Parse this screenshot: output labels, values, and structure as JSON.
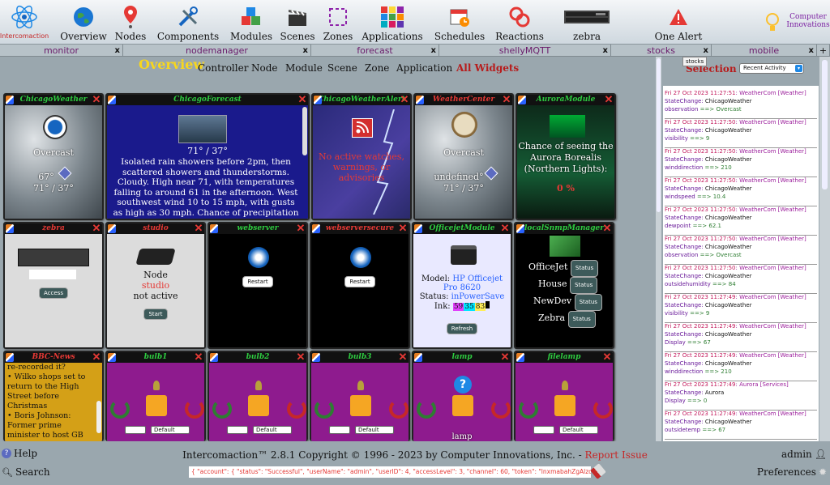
{
  "app": {
    "brand": "Intercomaction",
    "corner": "Computer Innovations"
  },
  "nav": [
    "Overview",
    "Nodes",
    "Components",
    "Modules",
    "Scenes",
    "Zones",
    "Applications",
    "Schedules",
    "Reactions",
    "zebra",
    "One Alert"
  ],
  "tabs": [
    "monitor",
    "nodemanager",
    "forecast",
    "shellyMQTT",
    "stocks",
    "mobile"
  ],
  "tab_close": "x",
  "tab_plus": "+",
  "tooltip": "stocks",
  "subnav": {
    "title": "Overview",
    "items": [
      "Controller",
      "Node",
      "Module",
      "Scene",
      "Zone",
      "Application"
    ],
    "active": "All Widgets"
  },
  "sidebar": {
    "title": "Selection",
    "select": "Recent Activity",
    "events": [
      {
        "time": "Fri 27 Oct 2023 11:27:51",
        "src": "WeatherCom [Weather]",
        "who": "ChicagoWeather",
        "key": "observation",
        "val": "Overcast"
      },
      {
        "time": "Fri 27 Oct 2023 11:27:50",
        "src": "WeatherCom [Weather]",
        "who": "ChicagoWeather",
        "key": "visibility",
        "val": "9"
      },
      {
        "time": "Fri 27 Oct 2023 11:27:50",
        "src": "WeatherCom [Weather]",
        "who": "ChicagoWeather",
        "key": "winddirection",
        "val": "210"
      },
      {
        "time": "Fri 27 Oct 2023 11:27:50",
        "src": "WeatherCom [Weather]",
        "who": "ChicagoWeather",
        "key": "windspeed",
        "val": "10.4"
      },
      {
        "time": "Fri 27 Oct 2023 11:27:50",
        "src": "WeatherCom [Weather]",
        "who": "ChicagoWeather",
        "key": "dewpoint",
        "val": "62.1"
      },
      {
        "time": "Fri 27 Oct 2023 11:27:50",
        "src": "WeatherCom [Weather]",
        "who": "ChicagoWeather",
        "key": "observation",
        "val": "Overcast"
      },
      {
        "time": "Fri 27 Oct 2023 11:27:50",
        "src": "WeatherCom [Weather]",
        "who": "ChicagoWeather",
        "key": "outsidehumidity",
        "val": "84"
      },
      {
        "time": "Fri 27 Oct 2023 11:27:49",
        "src": "WeatherCom [Weather]",
        "who": "ChicagoWeather",
        "key": "visibility",
        "val": "9"
      },
      {
        "time": "Fri 27 Oct 2023 11:27:49",
        "src": "WeatherCom [Weather]",
        "who": "ChicagoWeather",
        "key": "Display",
        "val": "67"
      },
      {
        "time": "Fri 27 Oct 2023 11:27:49",
        "src": "WeatherCom [Weather]",
        "who": "ChicagoWeather",
        "key": "winddirection",
        "val": "210"
      },
      {
        "time": "Fri 27 Oct 2023 11:27:49",
        "src": "Aurora [Services]",
        "who": "Aurora",
        "key": "Display",
        "val": "0"
      },
      {
        "time": "Fri 27 Oct 2023 11:27:49",
        "src": "WeatherCom [Weather]",
        "who": "ChicagoWeather",
        "key": "outsidetemp",
        "val": "67"
      }
    ]
  },
  "w": {
    "chicagoweather": {
      "title": "ChicagoWeather",
      "cond": "Overcast",
      "temp": "67°",
      "hilo": "71° / 37°"
    },
    "forecast": {
      "title": "ChicagoForecast",
      "hilo": "71° / 37°",
      "text": "Isolated rain showers before 2pm, then scattered showers and thunderstorms. Cloudy. High near 71, with temperatures falling to around 61 in the afternoon. West southwest wind 10 to 15 mph, with gusts as high as 30 mph. Chance of precipitation is"
    },
    "alert": {
      "title": "ChicagoWeatherAlert",
      "text": "No active watches, warnings, or advisories"
    },
    "center": {
      "title": "WeatherCenter",
      "cond": "Overcast",
      "temp": "undefined°",
      "hilo": "71° / 37°"
    },
    "aurora": {
      "title": "AuroraModule",
      "text": "Chance of seeing the Aurora Borealis (Northern Lights):",
      "val": "0 %"
    },
    "zebra": {
      "title": "zebra",
      "btn": "Access"
    },
    "studio": {
      "title": "studio",
      "l1": "Node",
      "l2": "studio",
      "l3": "not active",
      "btn": "Start"
    },
    "webserver": {
      "title": "webserver",
      "btn": "Restart"
    },
    "webserversecure": {
      "title": "webserversecure",
      "btn": "Restart"
    },
    "officejet": {
      "title": "OfficejetModule",
      "model_lbl": "Model:",
      "model": "HP Officejet Pro 8620",
      "status_lbl": "Status:",
      "status": "inPowerSave",
      "ink_lbl": "Ink:",
      "ink": [
        "59",
        "35",
        "83"
      ],
      "btn": "Refresh"
    },
    "snmp": {
      "title": "localSnmpManager",
      "rows": [
        "OfficeJet",
        "House",
        "NewDev",
        "Zebra"
      ],
      "btn": "Status"
    },
    "bbc": {
      "title": "BBC-News",
      "text": "re-recorded it?\n• Wilko shops set to return to the High Street before Christmas\n• Boris Johnson: Former prime minister to host GB News show\n• Abercrombie & Fitch and"
    },
    "bulbs": [
      "bulb1",
      "bulb2",
      "bulb3",
      "lamp",
      "filelamp"
    ],
    "default_opt": "Default",
    "lamp_label": "lamp"
  },
  "footer": {
    "help": "Help",
    "search": "Search",
    "copyright": "Intercomaction™ 2.8.1 Copyright © 1996 - 2023 by Computer Innovations, Inc. - ",
    "report": "Report Issue",
    "json": "{ \"account\": { \"status\": \"Successful\", \"userName\": \"admin\", \"userID\": 4, \"accessLevel\": 3, \"channel\": 60, \"token\": \"lnxmabahZgAlzcQi",
    "user": "admin",
    "prefs": "Preferences"
  }
}
